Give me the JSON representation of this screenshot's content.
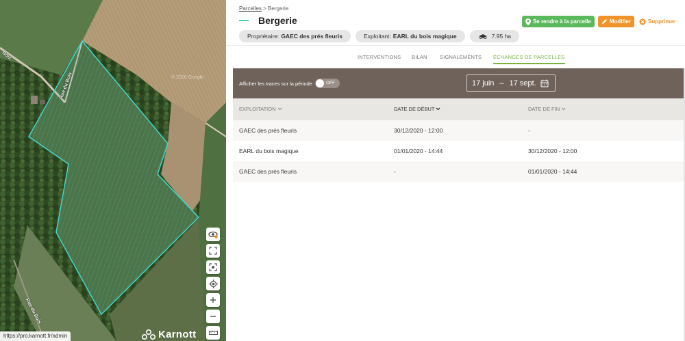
{
  "map": {
    "road_labels": [
      "Bois",
      "Rue du Bois",
      "Rue du Bois"
    ],
    "copyright": "© 2020 Google",
    "status_url": "https://pro.karnott.fr/admin",
    "brand": "Karnott",
    "controls": [
      "eye-icon",
      "fullscreen-icon",
      "focus-icon",
      "locate-icon",
      "zoom-in-icon",
      "zoom-out-icon",
      "ruler-icon"
    ],
    "parcel_color": "#40d8d0"
  },
  "breadcrumb": {
    "link": "Parcelles",
    "separator": ">",
    "current": "Bergerie"
  },
  "title": "Bergerie",
  "actions": {
    "go": "Se rendre à la parcelle",
    "edit": "Modifier",
    "delete": "Supprimer"
  },
  "chips": {
    "owner_label": "Propriétaire:",
    "owner_value": "GAEC des prés fleuris",
    "operator_label": "Exploitant:",
    "operator_value": "EARL du bois magique",
    "area": "7.95 ha"
  },
  "tabs": [
    {
      "label": "INTERVENTIONS",
      "active": false
    },
    {
      "label": "BILAN",
      "active": false
    },
    {
      "label": "SIGNALEMENTS",
      "active": false
    },
    {
      "label": "ÉCHANGES DE PARCELLES",
      "active": true
    }
  ],
  "filter": {
    "traces_label": "Afficher les traces sur la période",
    "toggle_state": "OFF",
    "date_start": "17 juin",
    "date_separator": "–",
    "date_end": "17 sept."
  },
  "table": {
    "columns": [
      "EXPLOITATION",
      "DATE DE DÉBUT",
      "DATE DE FIN"
    ],
    "sorted_column": "DATE DE DÉBUT",
    "rows": [
      [
        "GAEC des prés fleuris",
        "30/12/2020 - 12:00",
        "-"
      ],
      [
        "EARL du bois magique",
        "01/01/2020 - 14:44",
        "30/12/2020 - 12:00"
      ],
      [
        "GAEC des prés fleuris",
        "-",
        "01/01/2020 - 14:44"
      ]
    ]
  },
  "colors": {
    "accent_green": "#7ab342",
    "button_green": "#5cb85c",
    "button_orange": "#f0932b",
    "filter_bar": "#6f625a",
    "title_dash": "#4dc7c4"
  }
}
